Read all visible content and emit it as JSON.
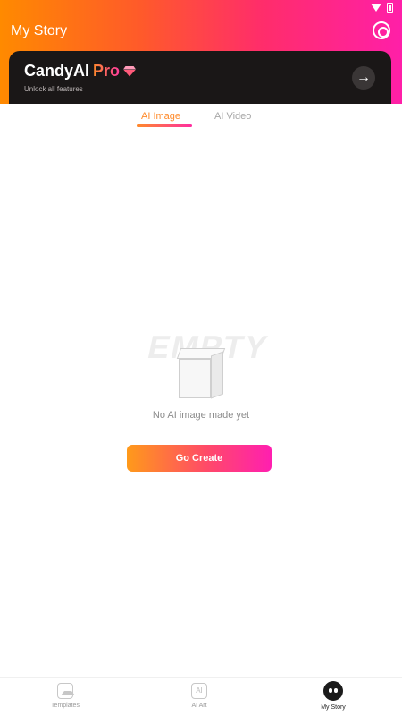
{
  "header": {
    "title": "My Story",
    "settings_icon": "gear-icon"
  },
  "pro_banner": {
    "brand": "CandyAI",
    "pro": "Pro",
    "subtitle": "Unlock all features",
    "arrow_icon": "arrow-right-icon"
  },
  "tabs": [
    {
      "label": "AI Image",
      "active": true
    },
    {
      "label": "AI Video",
      "active": false
    }
  ],
  "empty_state": {
    "illustration_text": "EMPTY",
    "message": "No AI image made yet",
    "button_label": "Go Create"
  },
  "bottom_nav": [
    {
      "label": "Templates",
      "icon": "image-icon",
      "active": false
    },
    {
      "label": "AI Art",
      "icon": "ai-icon",
      "icon_text": "AI",
      "active": false
    },
    {
      "label": "My Story",
      "icon": "story-icon",
      "active": true
    }
  ],
  "colors": {
    "accent_start": "#ff8a00",
    "accent_end": "#ff1fa8",
    "banner_bg": "#1a1717"
  }
}
